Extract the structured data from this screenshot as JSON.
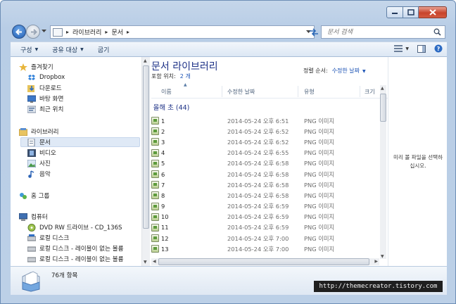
{
  "nav": {
    "breadcrumbs": [
      "라이브러리",
      "문서"
    ],
    "search_placeholder": "문서 검색"
  },
  "toolbar": {
    "organize": "구성",
    "share": "공유 대상",
    "burn": "굽기"
  },
  "sidebar": {
    "favorites_header": "즐겨찾기",
    "favorites": [
      "Dropbox",
      "다운로드",
      "바탕 화면",
      "최근 위치"
    ],
    "libraries_header": "라이브러리",
    "libraries": [
      "문서",
      "비디오",
      "사진",
      "음악"
    ],
    "selected": "문서",
    "homegroup": "홈 그룹",
    "computer_header": "컴퓨터",
    "computer": [
      "DVD RW 드라이브 - CD_136S",
      "로컬 디스크",
      "로컬 디스크 - 레이블이 없는 볼륨",
      "로컬 디스크 - 레이블이 없는 볼륨"
    ]
  },
  "library": {
    "title": "문서 라이브러리",
    "includes_label": "포함 위치:",
    "includes_value": "2 개",
    "sort_label": "정렬 순서:",
    "sort_value": "수정한 날짜"
  },
  "columns": {
    "name": "이름",
    "modified": "수정한 날짜",
    "type": "유형",
    "size": "크기"
  },
  "group": {
    "label": "올해 초 (44)"
  },
  "files": [
    {
      "name": "1",
      "date": "2014-05-24 오후 6:51",
      "type": "PNG 이미지"
    },
    {
      "name": "2",
      "date": "2014-05-24 오후 6:52",
      "type": "PNG 이미지"
    },
    {
      "name": "3",
      "date": "2014-05-24 오후 6:52",
      "type": "PNG 이미지"
    },
    {
      "name": "4",
      "date": "2014-05-24 오후 6:55",
      "type": "PNG 이미지"
    },
    {
      "name": "5",
      "date": "2014-05-24 오후 6:58",
      "type": "PNG 이미지"
    },
    {
      "name": "6",
      "date": "2014-05-24 오후 6:58",
      "type": "PNG 이미지"
    },
    {
      "name": "7",
      "date": "2014-05-24 오후 6:58",
      "type": "PNG 이미지"
    },
    {
      "name": "8",
      "date": "2014-05-24 오후 6:58",
      "type": "PNG 이미지"
    },
    {
      "name": "9",
      "date": "2014-05-24 오후 6:59",
      "type": "PNG 이미지"
    },
    {
      "name": "10",
      "date": "2014-05-24 오후 6:59",
      "type": "PNG 이미지"
    },
    {
      "name": "11",
      "date": "2014-05-24 오후 6:59",
      "type": "PNG 이미지"
    },
    {
      "name": "12",
      "date": "2014-05-24 오후 7:00",
      "type": "PNG 이미지"
    },
    {
      "name": "13",
      "date": "2014-05-24 오후 7:00",
      "type": "PNG 이미지"
    }
  ],
  "preview": {
    "message": "미리 볼 파일을 선택하십시오."
  },
  "details": {
    "item_count": "76개 항목"
  },
  "watermark": "http://themecreator.tistory.com",
  "colors": {
    "title_blue": "#1e3287",
    "link_blue": "#1c53b5",
    "frame": "#bcd0e7"
  }
}
